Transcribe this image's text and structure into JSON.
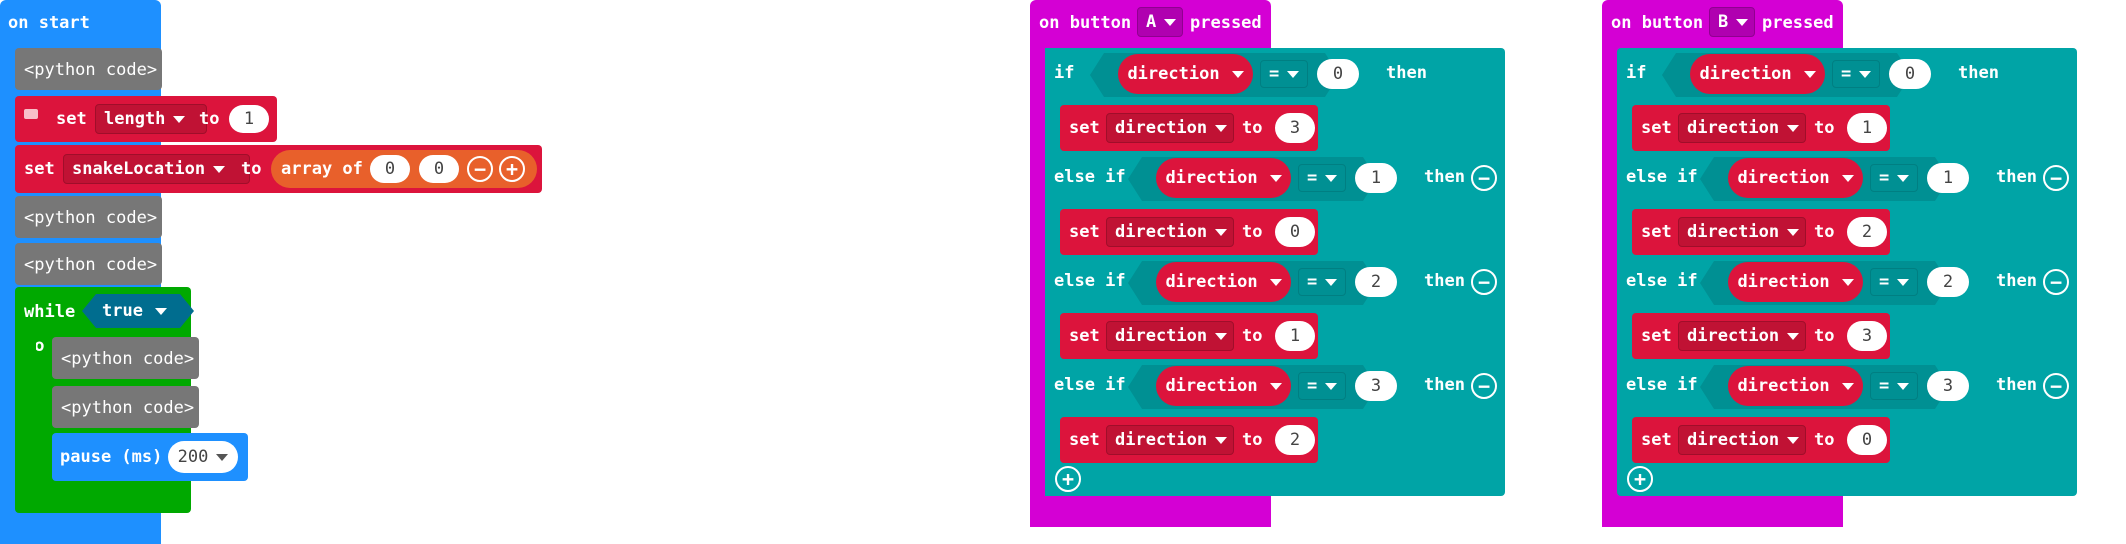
{
  "colors": {
    "event_blue": "#1E90FF",
    "python_gray": "#777777",
    "variables_red": "#DC143C",
    "array_orange": "#E8602B",
    "loop_green": "#00A900",
    "logic_teal": "#00A4A6",
    "input_magenta": "#D400D4"
  },
  "on_start": {
    "header": "on start",
    "python1": "<python code>",
    "set_length": {
      "set": "set",
      "var": "length",
      "to": "to",
      "value": "1",
      "comment_icon": "comment-icon"
    },
    "set_snake": {
      "set": "set",
      "var": "snakeLocation",
      "to": "to",
      "array_of": "array of",
      "v1": "0",
      "v2": "0"
    },
    "python2": "<python code>",
    "python3": "<python code>",
    "while_loop": {
      "while": "while",
      "condition": "true",
      "do": "do",
      "python4": "<python code>",
      "python5": "<python code>",
      "pause_label": "pause (ms)",
      "pause_value": "200"
    }
  },
  "button_a": {
    "on": "on button",
    "button": "A",
    "pressed": "pressed",
    "branches": [
      {
        "kw": "if",
        "var": "direction",
        "op": "=",
        "cmp": "0",
        "then": "then",
        "set": "set",
        "set_var": "direction",
        "to": "to",
        "val": "3"
      },
      {
        "kw": "else if",
        "var": "direction",
        "op": "=",
        "cmp": "1",
        "then": "then",
        "set": "set",
        "set_var": "direction",
        "to": "to",
        "val": "0"
      },
      {
        "kw": "else if",
        "var": "direction",
        "op": "=",
        "cmp": "2",
        "then": "then",
        "set": "set",
        "set_var": "direction",
        "to": "to",
        "val": "1"
      },
      {
        "kw": "else if",
        "var": "direction",
        "op": "=",
        "cmp": "3",
        "then": "then",
        "set": "set",
        "set_var": "direction",
        "to": "to",
        "val": "2"
      }
    ]
  },
  "button_b": {
    "on": "on button",
    "button": "B",
    "pressed": "pressed",
    "branches": [
      {
        "kw": "if",
        "var": "direction",
        "op": "=",
        "cmp": "0",
        "then": "then",
        "set": "set",
        "set_var": "direction",
        "to": "to",
        "val": "1"
      },
      {
        "kw": "else if",
        "var": "direction",
        "op": "=",
        "cmp": "1",
        "then": "then",
        "set": "set",
        "set_var": "direction",
        "to": "to",
        "val": "2"
      },
      {
        "kw": "else if",
        "var": "direction",
        "op": "=",
        "cmp": "2",
        "then": "then",
        "set": "set",
        "set_var": "direction",
        "to": "to",
        "val": "3"
      },
      {
        "kw": "else if",
        "var": "direction",
        "op": "=",
        "cmp": "3",
        "then": "then",
        "set": "set",
        "set_var": "direction",
        "to": "to",
        "val": "0"
      }
    ]
  }
}
